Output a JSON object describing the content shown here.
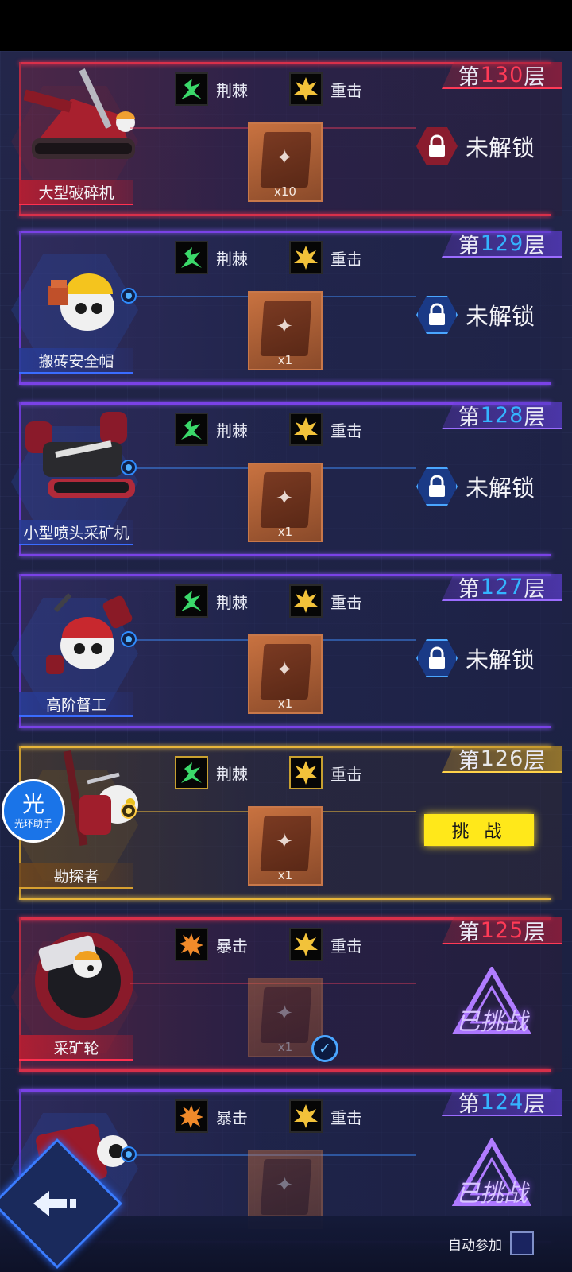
{
  "rows": [
    {
      "floor_prefix": "第",
      "floor_num": "130",
      "floor_suffix": "层",
      "theme": "red",
      "buffs": [
        {
          "label": "荆棘",
          "icon": "thorns-icon"
        },
        {
          "label": "重击",
          "icon": "heavy-strike-icon"
        }
      ],
      "boss_name": "大型破碎机",
      "reward_count": "x10",
      "status": "未解锁"
    },
    {
      "floor_prefix": "第",
      "floor_num": "129",
      "floor_suffix": "层",
      "theme": "purple",
      "buffs": [
        {
          "label": "荆棘",
          "icon": "thorns-icon"
        },
        {
          "label": "重击",
          "icon": "heavy-strike-icon"
        }
      ],
      "boss_name": "搬砖安全帽",
      "reward_count": "x1",
      "status": "未解锁"
    },
    {
      "floor_prefix": "第",
      "floor_num": "128",
      "floor_suffix": "层",
      "theme": "purple",
      "buffs": [
        {
          "label": "荆棘",
          "icon": "thorns-icon"
        },
        {
          "label": "重击",
          "icon": "heavy-strike-icon"
        }
      ],
      "boss_name": "小型喷头采矿机",
      "reward_count": "x1",
      "status": "未解锁"
    },
    {
      "floor_prefix": "第",
      "floor_num": "127",
      "floor_suffix": "层",
      "theme": "purple",
      "buffs": [
        {
          "label": "荆棘",
          "icon": "thorns-icon"
        },
        {
          "label": "重击",
          "icon": "heavy-strike-icon"
        }
      ],
      "boss_name": "高阶督工",
      "reward_count": "x1",
      "status": "未解锁"
    },
    {
      "floor_prefix": "第",
      "floor_num": "126",
      "floor_suffix": "层",
      "theme": "gold",
      "buffs": [
        {
          "label": "荆棘",
          "icon": "thorns-icon"
        },
        {
          "label": "重击",
          "icon": "heavy-strike-icon"
        }
      ],
      "boss_name": "勘探者",
      "reward_count": "x1",
      "status": "挑 战"
    },
    {
      "floor_prefix": "第",
      "floor_num": "125",
      "floor_suffix": "层",
      "theme": "red",
      "buffs": [
        {
          "label": "暴击",
          "icon": "critical-hit-icon"
        },
        {
          "label": "重击",
          "icon": "heavy-strike-icon"
        }
      ],
      "boss_name": "采矿轮",
      "reward_count": "x1",
      "status": "已挑战"
    },
    {
      "floor_prefix": "第",
      "floor_num": "124",
      "floor_suffix": "层",
      "theme": "purple",
      "buffs": [
        {
          "label": "暴击",
          "icon": "critical-hit-icon"
        },
        {
          "label": "重击",
          "icon": "heavy-strike-icon"
        }
      ],
      "boss_name": "",
      "reward_count": "",
      "status": "已挑战"
    }
  ],
  "helper": {
    "glyph": "光",
    "label": "光环助手"
  },
  "bottom": {
    "auto_join_label": "自动参加"
  },
  "colors": {
    "accent_blue": "#34b4ff",
    "challenge_yellow": "#ffe81a",
    "purple_border": "#7a42e6",
    "red_border": "#d8304a",
    "gold_border": "#e8b63a"
  }
}
